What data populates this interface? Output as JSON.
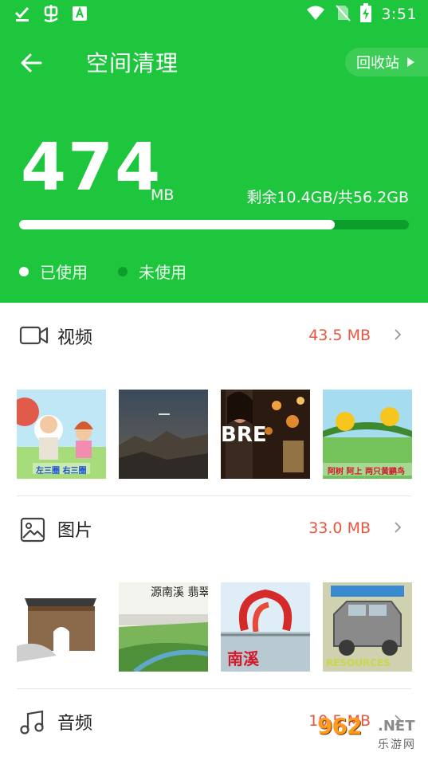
{
  "status_bar": {
    "time": "3:51",
    "icons": [
      "download-done-icon",
      "app-bug-icon",
      "app-a-icon",
      "wifi-icon",
      "no-sim-icon",
      "battery-charging-icon"
    ]
  },
  "toolbar": {
    "title": "空间清理",
    "recycle_label": "回收站"
  },
  "storage": {
    "used_value": "474",
    "used_unit": "MB",
    "remaining_text": "剩余10.4GB/共56.2GB",
    "progress_fraction": 0.81,
    "legend_used": "已使用",
    "legend_unused": "未使用"
  },
  "sections": [
    {
      "label": "视频",
      "size": "43.5 MB",
      "icon": "video-camera-icon",
      "thumbnails": [
        {
          "caption": "左三圈 右三圈"
        },
        {
          "caption": ""
        },
        {
          "caption": "BRE"
        },
        {
          "caption": "阿树 阿上 两只黄鹂鸟"
        }
      ]
    },
    {
      "label": "图片",
      "size": "33.0 MB",
      "icon": "image-icon",
      "thumbnails": [
        {
          "caption": ""
        },
        {
          "caption": "源南溪 翡翠江城"
        },
        {
          "caption": "南溪"
        },
        {
          "caption": "RESOURCES"
        }
      ]
    },
    {
      "label": "音频",
      "size": "10.5 MB",
      "icon": "music-note-icon"
    }
  ],
  "watermark": {
    "number": "962",
    "domain": ".NET",
    "name": "乐游网"
  },
  "colors": {
    "header_green": "#1ec63d",
    "progress_track": "#0b9e2a",
    "size_red": "#e8563d"
  }
}
